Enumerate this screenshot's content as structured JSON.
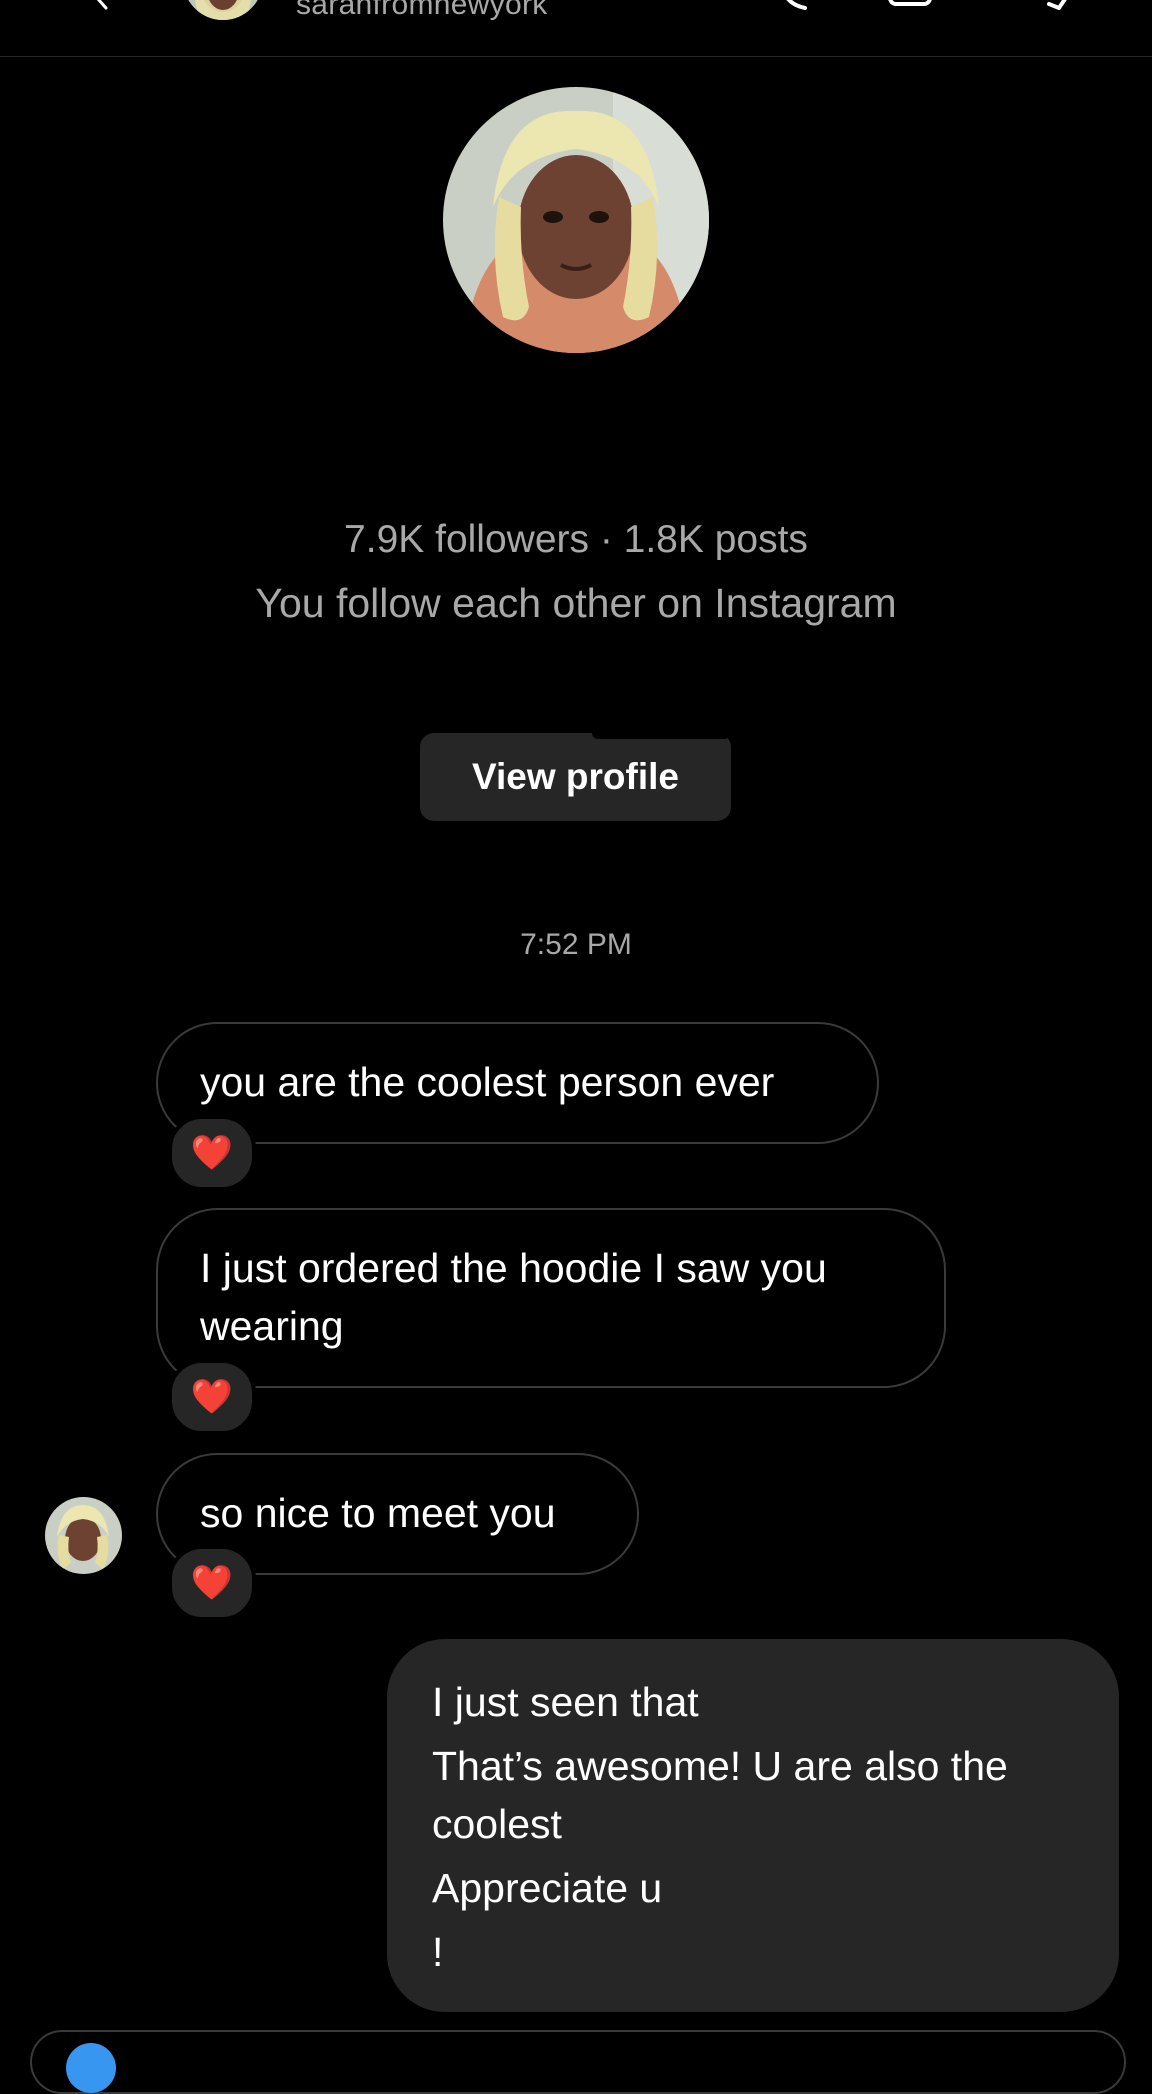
{
  "header": {
    "username": "sarahfromnewyork",
    "icons": [
      "chevron-left-icon",
      "phone-icon",
      "video-camera-icon",
      "flag-icon"
    ]
  },
  "profile": {
    "stats": "7.9K followers · 1.8K posts",
    "follow_note": "You follow each other on Instagram",
    "view_profile_label": "View profile"
  },
  "chat": {
    "timestamp": "7:52 PM",
    "incoming": [
      {
        "lines": [
          "you are the coolest person ever"
        ],
        "reaction": "❤️"
      },
      {
        "lines": [
          "I just ordered the hoodie I saw you",
          "wearing"
        ],
        "reaction": "❤️"
      },
      {
        "lines": [
          "so nice to meet you"
        ],
        "reaction": "❤️"
      }
    ],
    "outgoing": {
      "lines": [
        "I just seen that",
        "That’s awesome! U are also the",
        "coolest",
        "Appreciate u",
        "!"
      ]
    }
  },
  "colors": {
    "background": "#000000",
    "bubble_outgoing": "#262626",
    "bubble_border": "#3a3a3a",
    "secondary_text": "#a8a8a8",
    "accent": "#3797f0"
  }
}
